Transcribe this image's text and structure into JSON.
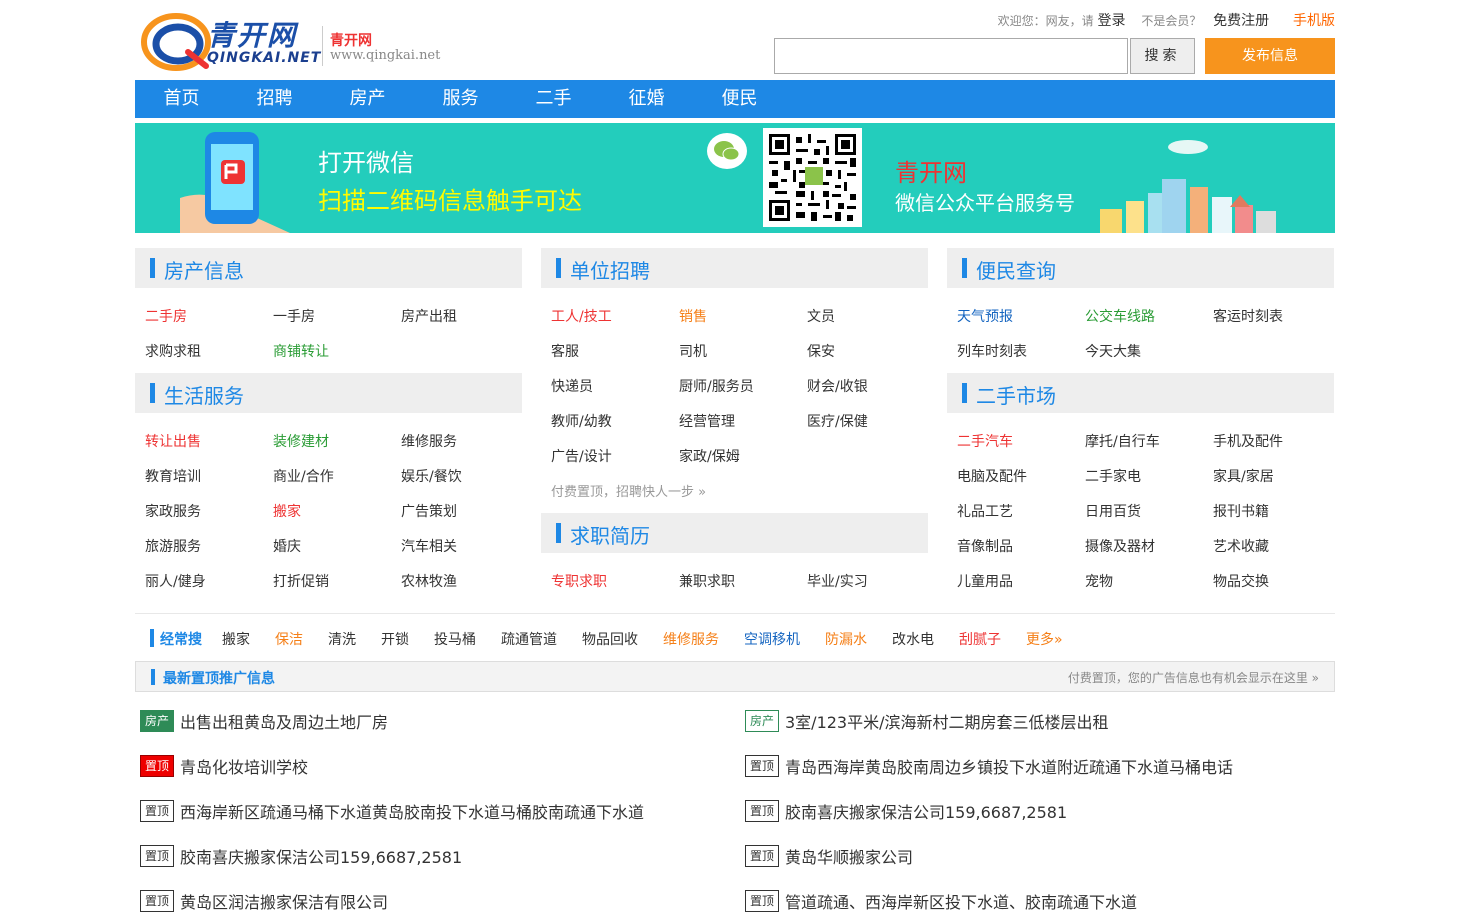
{
  "header": {
    "site_name": "青开网",
    "logo_cn": "青开网",
    "logo_en": "QINGKAI.NET",
    "site_url": "www.qingkai.net",
    "welcome": "欢迎您：网友，请",
    "login": "登录",
    "not_member": "不是会员？",
    "register": "免费注册",
    "mobile": "手机版",
    "search_placeholder": "",
    "search_button": "搜索",
    "post_button": "发布信息"
  },
  "nav": [
    "首页",
    "招聘",
    "房产",
    "服务",
    "二手",
    "征婚",
    "便民"
  ],
  "banner": {
    "line1": "打开微信",
    "line2": "扫描二维码信息触手可达",
    "brand": "青开网",
    "sub": "微信公众平台服务号"
  },
  "sections": {
    "house": {
      "title": "房产信息",
      "links": [
        "二手房",
        "一手房",
        "房产出租",
        "求购求租",
        "商铺转让"
      ]
    },
    "life": {
      "title": "生活服务",
      "links": [
        "转让出售",
        "装修建材",
        "维修服务",
        "教育培训",
        "商业/合作",
        "娱乐/餐饮",
        "家政服务",
        "搬家",
        "广告策划",
        "旅游服务",
        "婚庆",
        "汽车相关",
        "丽人/健身",
        "打折促销",
        "农林牧渔"
      ]
    },
    "jobs": {
      "title": "单位招聘",
      "links": [
        "工人/技工",
        "销售",
        "文员",
        "客服",
        "司机",
        "保安",
        "快递员",
        "厨师/服务员",
        "财会/收银",
        "教师/幼教",
        "经营管理",
        "医疗/保健",
        "广告/设计",
        "家政/保姆"
      ],
      "promo": "付费置顶，招聘快人一步 »"
    },
    "resume": {
      "title": "求职简历",
      "links": [
        "专职求职",
        "兼职求职",
        "毕业/实习"
      ]
    },
    "query": {
      "title": "便民查询",
      "links": [
        "天气预报",
        "公交车线路",
        "客运时刻表",
        "列车时刻表",
        "今天大集"
      ]
    },
    "market": {
      "title": "二手市场",
      "links": [
        "二手汽车",
        "摩托/自行车",
        "手机及配件",
        "电脑及配件",
        "二手家电",
        "家具/家居",
        "礼品工艺",
        "日用百货",
        "报刊书籍",
        "音像制品",
        "摄像及器材",
        "艺术收藏",
        "儿童用品",
        "宠物",
        "物品交换"
      ]
    }
  },
  "common_search": {
    "title": "经常搜",
    "items": [
      "搬家",
      "保洁",
      "清洗",
      "开锁",
      "投马桶",
      "疏通管道",
      "物品回收",
      "维修服务",
      "空调移机",
      "防漏水",
      "改水电",
      "刮腻子",
      "更多»"
    ]
  },
  "latest": {
    "title": "最新置顶推广信息",
    "right": "付费置顶，您的广告信息也有机会显示在这里 »",
    "left": [
      {
        "tag": "房产",
        "text": "出售出租黄岛及周边土地厂房"
      },
      {
        "tag": "置顶",
        "text": "青岛化妆培训学校"
      },
      {
        "tag": "置顶",
        "text": "西海岸新区疏通马桶下水道黄岛胶南投下水道马桶胶南疏通下水道"
      },
      {
        "tag": "置顶",
        "text": "胶南喜庆搬家保洁公司159,6687,2581"
      },
      {
        "tag": "置顶",
        "text": "黄岛区润洁搬家保洁有限公司"
      }
    ],
    "right_items": [
      {
        "tag": "房产",
        "text": "3室/123平米/滨海新村二期房套三低楼层出租"
      },
      {
        "tag": "置顶",
        "text": "青岛西海岸黄岛胶南周边乡镇投下水道附近疏通下水道马桶电话"
      },
      {
        "tag": "置顶",
        "text": "胶南喜庆搬家保洁公司159,6687,2581"
      },
      {
        "tag": "置顶",
        "text": "黄岛华顺搬家公司"
      },
      {
        "tag": "置顶",
        "text": "管道疏通、西海岸新区投下水道、胶南疏通下水道"
      }
    ]
  }
}
